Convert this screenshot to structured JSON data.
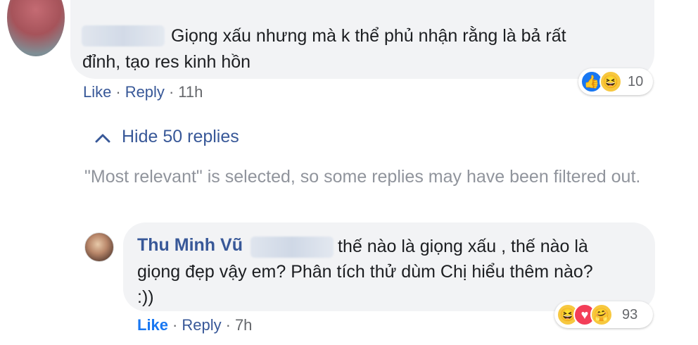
{
  "comment": {
    "text_line1": "Giọng xấu nhưng mà k thể phủ nhận rằng là bả rất",
    "text_line2": "đỉnh, tạo res kinh hồn",
    "reaction_count": "10",
    "reaction_icons": [
      "like-icon",
      "haha-icon"
    ],
    "actions": {
      "like": "Like",
      "reply": "Reply",
      "time": "11h",
      "separator": "·"
    }
  },
  "replies_toggle": {
    "chevron": "^",
    "label": "Hide 50 replies"
  },
  "filter_note": "\"Most relevant\" is selected, so some replies may have been filtered out.",
  "reply": {
    "author": "Thu Minh Vũ",
    "text_line1": "thế nào là giọng xấu , thế nào là",
    "text_line2": "giọng đẹp vậy em? Phân tích thử dùm Chị hiểu thêm nào?",
    "text_line3": ":))",
    "reaction_count": "93",
    "reaction_icons": [
      "haha-icon",
      "love-icon",
      "care-icon"
    ],
    "actions": {
      "like": "Like",
      "reply": "Reply",
      "time": "7h",
      "separator": "·"
    }
  },
  "colors": {
    "link": "#385898",
    "bubble": "#f2f3f5",
    "muted": "#90949c",
    "like_active": "#1877f2"
  }
}
